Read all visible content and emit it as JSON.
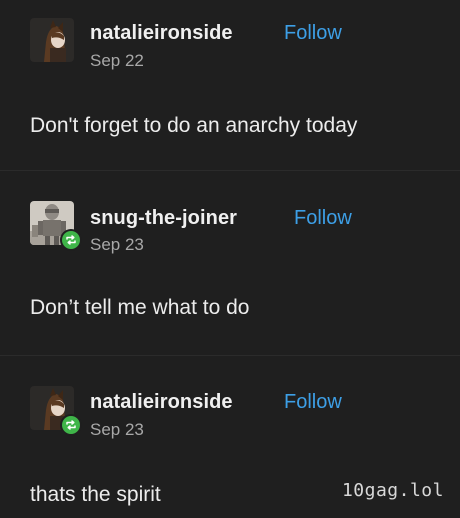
{
  "posts": [
    {
      "username": "natalieironside",
      "follow_label": "Follow",
      "date": "Sep 22",
      "text": "Don't forget to do an anarchy today"
    },
    {
      "username": "snug-the-joiner",
      "follow_label": "Follow",
      "date": "Sep 23",
      "text": "Don’t tell me what to do"
    },
    {
      "username": "natalieironside",
      "follow_label": "Follow",
      "date": "Sep 23",
      "text": "thats the spirit"
    }
  ],
  "watermark": "10gag.lol",
  "colors": {
    "background": "#1f1f1f",
    "follow": "#3d9fe6",
    "reblog_badge": "#3fb549"
  }
}
